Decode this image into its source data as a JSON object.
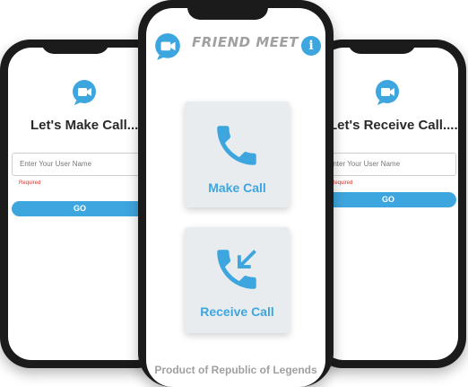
{
  "left_screen": {
    "title": "Let's Make Call....",
    "input_placeholder": "Enter Your User Name",
    "required_text": "Required",
    "go_label": "GO"
  },
  "right_screen": {
    "title": "Let's Receive Call....",
    "input_placeholder": "Enter Your User Name",
    "required_text": "Required",
    "go_label": "GO"
  },
  "center_screen": {
    "app_title": "FRIEND MEET",
    "info_label": "i",
    "make_call_label": "Make Call",
    "receive_call_label": "Receive Call",
    "footer": "Product of Republic of Legends"
  },
  "colors": {
    "accent": "#3ea6de",
    "card_bg": "#e9ecef",
    "required": "#e0302a"
  },
  "icons": [
    "video-chat-icon",
    "info-icon",
    "phone-icon",
    "incoming-call-icon"
  ]
}
